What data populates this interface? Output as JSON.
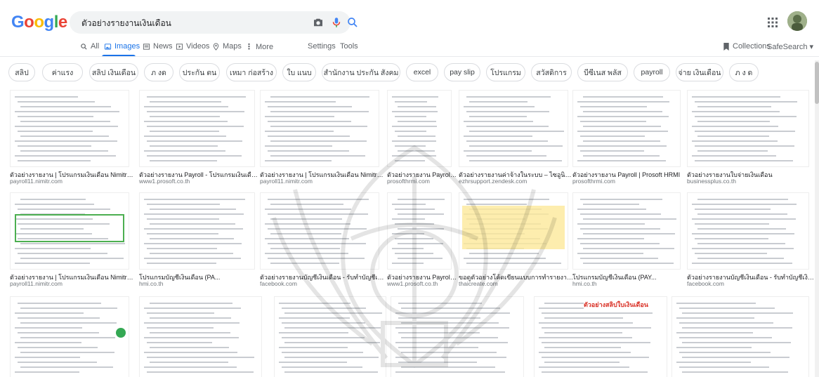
{
  "logo": {
    "letters": [
      "G",
      "o",
      "o",
      "g",
      "l",
      "e"
    ],
    "colors": [
      "#4285F4",
      "#EA4335",
      "#FBBC05",
      "#4285F4",
      "#34A853",
      "#EA4335"
    ]
  },
  "search": {
    "query": "ตัวอย่างรายงานเงินเดือน"
  },
  "icons": {
    "camera": "camera-icon",
    "mic": "mic-icon",
    "search": "search-icon",
    "apps": "apps-icon"
  },
  "nav": {
    "items": [
      {
        "label": "All",
        "icon": "search-icon"
      },
      {
        "label": "Images",
        "icon": "image-icon"
      },
      {
        "label": "News",
        "icon": "news-icon"
      },
      {
        "label": "Videos",
        "icon": "video-icon"
      },
      {
        "label": "Maps",
        "icon": "map-pin-icon"
      },
      {
        "label": "More",
        "icon": "more-icon"
      }
    ],
    "settings": "Settings",
    "tools": "Tools",
    "collections": "Collections",
    "safesearch": "SafeSearch ▾"
  },
  "chips": [
    "สลิป",
    "ค่าแรง",
    "สลิป เงินเดือน",
    "ภ งด",
    "ประกัน ตน",
    "เหมา ก่อสร้าง",
    "ใบ แนบ",
    "สำนักงาน ประกัน สังคม",
    "excel",
    "pay slip",
    "โปรแกรม",
    "สวัสดิการ",
    "บีซีเนส พลัส",
    "payroll",
    "จ่าย เงินเดือน",
    "ภ ง ด"
  ],
  "results": {
    "row1": [
      {
        "title": "ตัวอย่างรายงาน | โปรแกรมเงินเดือน Nimitr Payroll",
        "source": "payroll11.nimitr.com"
      },
      {
        "title": "ตัวอย่างรายงาน Payroll - โปรแกรมเงินเดือน H...",
        "source": "www1.prosoft.co.th"
      },
      {
        "title": "ตัวอย่างรายงาน | โปรแกรมเงินเดือน Nimitr Payroll",
        "source": "payroll11.nimitr.com"
      },
      {
        "title": "ตัวอย่างรายงาน Payroll | ...",
        "source": "prosofthrmi.com"
      },
      {
        "title": "ตัวอย่างรายงานค่าจ้างในระบบ – ไซอูนิโปรแ...",
        "source": "ezhrsupport.zendesk.com"
      },
      {
        "title": "ตัวอย่างรายงาน Payroll | Prosoft HRMI",
        "source": "prosofthrmi.com"
      },
      {
        "title": "ตัวอย่างรายงานใบจ่ายเงินเดือน",
        "source": "businessplus.co.th"
      }
    ],
    "row2": [
      {
        "title": "ตัวอย่างรายงาน | โปรแกรมเงินเดือน Nimitr Payroll",
        "source": "payroll11.nimitr.com"
      },
      {
        "title": "โปรแกรมบัญชีเงินเดือน (PA...",
        "source": "hmi.co.th"
      },
      {
        "title": "ตัวอย่างรายงานบัญชีเงินเดือน - รับทำบัญชีเงินเดือน...",
        "source": "facebook.com"
      },
      {
        "title": "ตัวอย่างรายงาน Payroll - โปรแกรมเงินเดือน HR...",
        "source": "www1.prosoft.co.th"
      },
      {
        "title": "ขอดูตัวอย่างโค้ดเขียนแบบการทำรายงานของรายงาน เดือน...",
        "source": "thaicreate.com"
      },
      {
        "title": "โปรแกรมบัญชีเงินเดือน (PAY...",
        "source": "hmi.co.th"
      },
      {
        "title": "ตัวอย่างรายงานบัญชีเงินเดือน - รับทำบัญชีเงินเดือน...",
        "source": "facebook.com"
      }
    ],
    "row3_banner": "ตัวอย่างสลิปใบเงินเดือน"
  }
}
